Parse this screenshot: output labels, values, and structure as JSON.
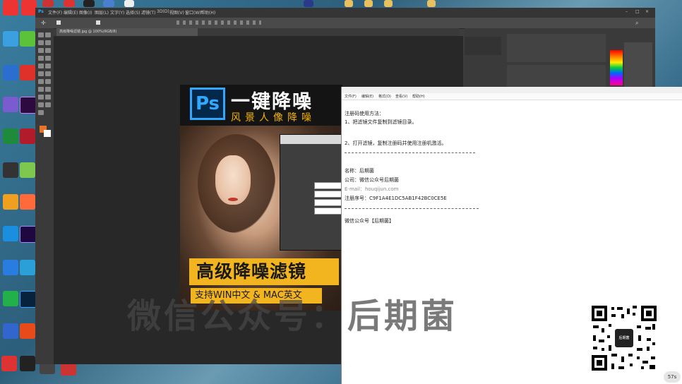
{
  "photoshop": {
    "app_badge": "Ps",
    "menu": [
      "文件(F)",
      "编辑(E)",
      "图像(I)",
      "图层(L)",
      "文字(Y)",
      "选择(S)",
      "滤镜(T)",
      "3D(D)",
      "视图(V)",
      "窗口(W)",
      "帮助(H)"
    ],
    "doc_tab": "高级降噪滤镜.jpg @ 100%(RGB/8)"
  },
  "poster": {
    "logo": "Ps",
    "title": "一键降噪",
    "subtitle": "风景人像降噪",
    "banner_main": "高级降噪滤镜",
    "banner_sub": "支持WIN中文 & MAC英文"
  },
  "watermark": "微信公众号：后期菌",
  "notepad": {
    "menu": [
      "文件(F)",
      "编辑(E)",
      "格式(O)",
      "查看(V)",
      "帮助(H)"
    ],
    "lines": [
      "注册码使用方法：",
      "1、把滤镜文件复制到滤镜目录。",
      "2、打开滤镜，复制注册码并使用注册机激活。",
      "名称：后期菌",
      "公司：微信公众号后期菌",
      "E-mail：houqijun.com",
      "注册序号：C9F1A4E1DC5AB1F42BC0CE5E",
      "微信公众号【后期菌】"
    ]
  },
  "qr_center": "后期菌",
  "speed_badge": "57s"
}
